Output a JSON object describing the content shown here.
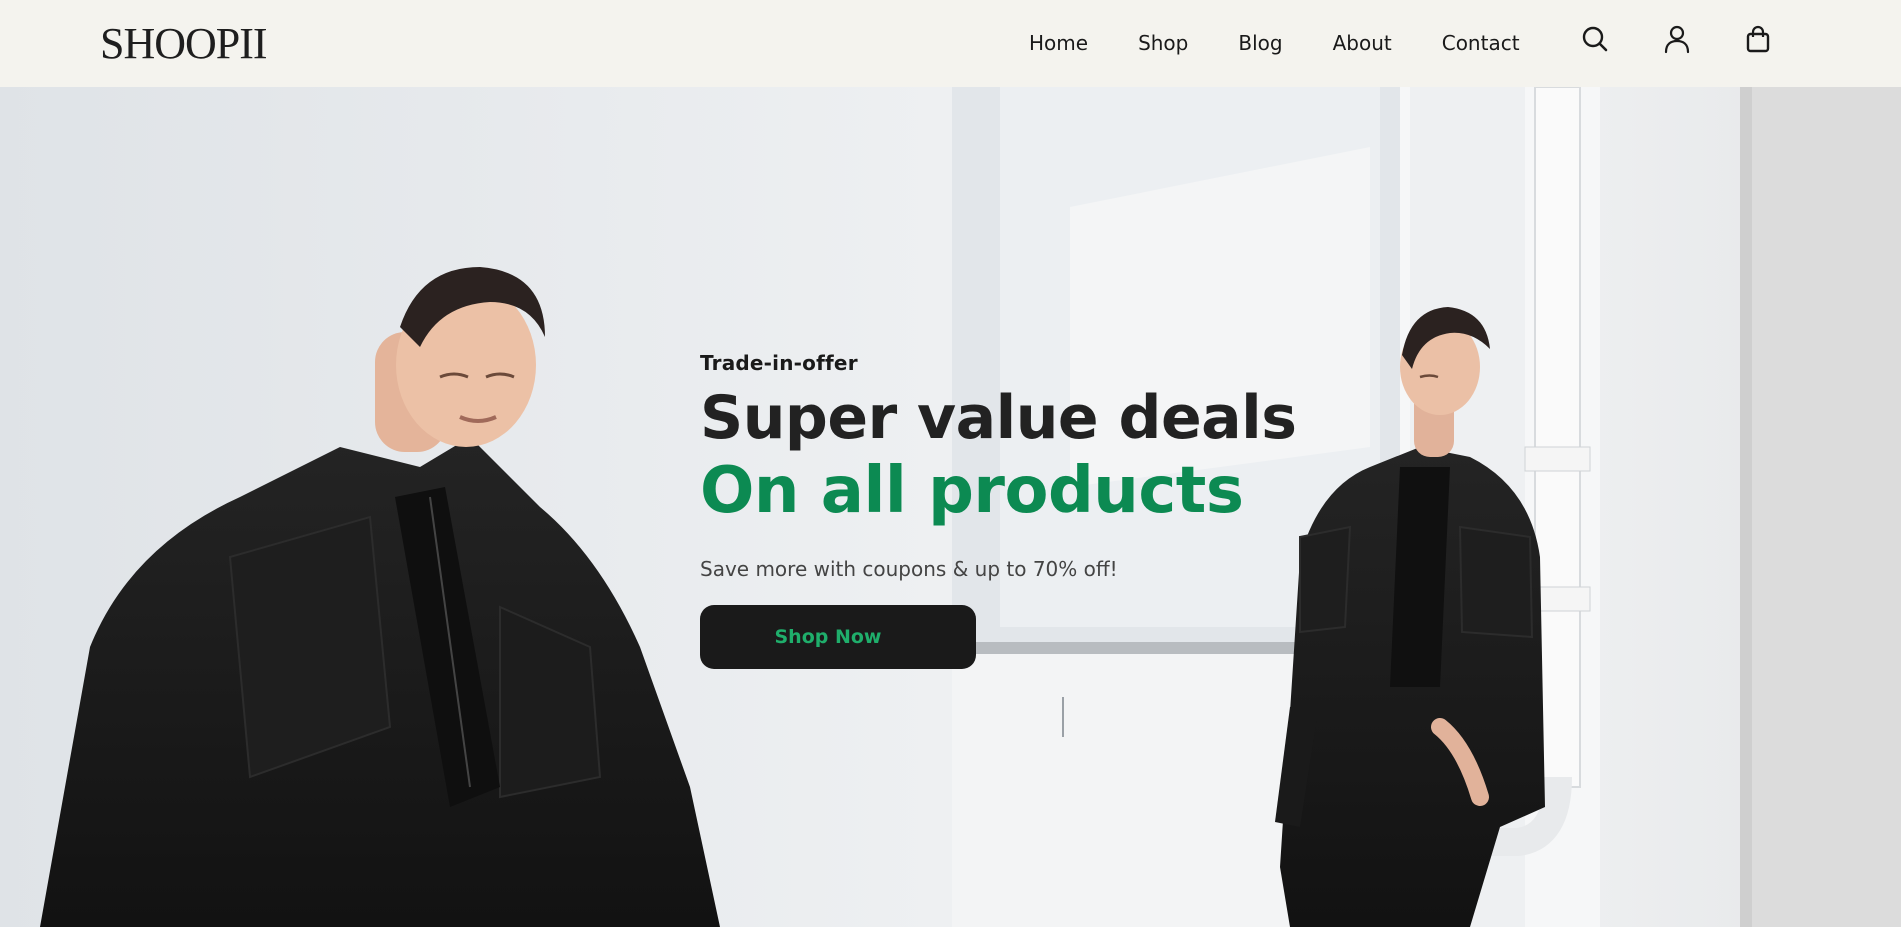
{
  "brand": {
    "logo_text": "SHOOPII"
  },
  "nav": {
    "items": [
      {
        "label": "Home"
      },
      {
        "label": "Shop"
      },
      {
        "label": "Blog"
      },
      {
        "label": "About"
      },
      {
        "label": "Contact"
      }
    ]
  },
  "header_icons": [
    "search-icon",
    "user-icon",
    "shopping-bag-icon"
  ],
  "hero": {
    "kicker": "Trade-in-offer",
    "headline": "Super value deals",
    "headline_accent": "On all products",
    "subtext": "Save more with coupons & up to 70% off!",
    "cta_label": "Shop Now"
  },
  "colors": {
    "accent": "#0c8a52",
    "cta_text": "#1fae6b",
    "cta_background": "#1a1a1a",
    "header_background": "#f4f3ee"
  }
}
